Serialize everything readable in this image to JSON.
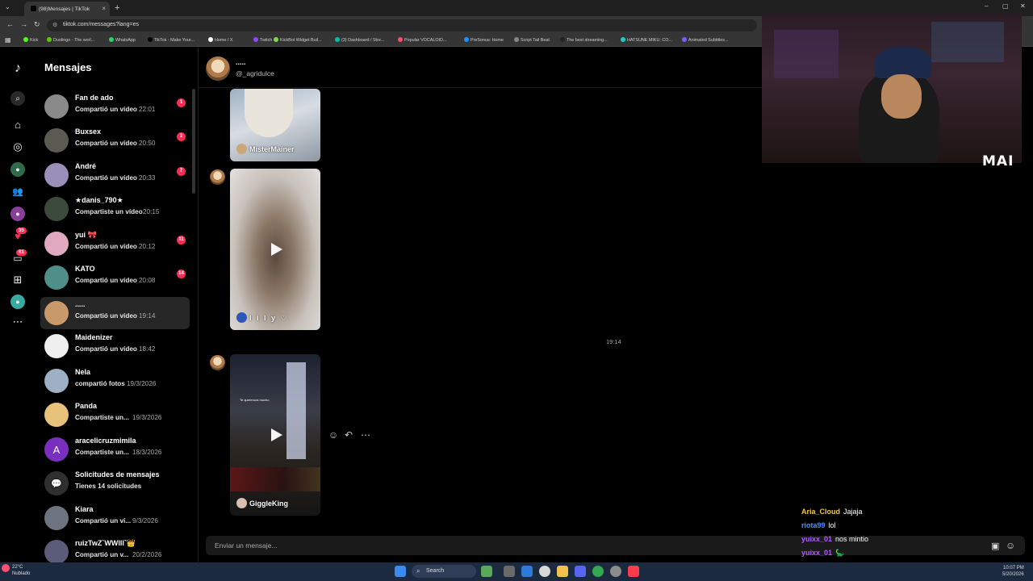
{
  "browser": {
    "tab_title": "(98)Mensajes | TikTok",
    "url": "tiktok.com/messages?lang=es",
    "bookmarks": [
      "Kick",
      "Duolingo - The worl...",
      "WhatsApp",
      "TikTok - Make Your...",
      "Home / X",
      "Twitch",
      "KickBot Widget Buil...",
      "(3) Dashboard / Stre...",
      "Popular VOCALOID...",
      "PreSonus: Home",
      "Script Tail Beat",
      "The best streaming...",
      "HATSUNE MIKU: CO...",
      "Animated Subtitles..."
    ]
  },
  "rail": {
    "badges": {
      "likes": "35",
      "inbox": "61"
    }
  },
  "sidebar": {
    "title": "Mensajes",
    "conversations": [
      {
        "name": "Fan de ado",
        "subtitle": "Compartió un vídeo",
        "time": "22:01",
        "badge": "1",
        "color": "#8a8a8a"
      },
      {
        "name": "Buxsex",
        "subtitle": "Compartió un vídeo",
        "time": "20:50",
        "badge": "2",
        "color": "#5a5a52"
      },
      {
        "name": "André",
        "subtitle": "Compartió un vídeo",
        "time": "20:33",
        "badge": "7",
        "color": "#9a8fb8"
      },
      {
        "name": "★danis_790★",
        "subtitle": "Compartiste un vídeo",
        "time": "20:15",
        "badge": "",
        "color": "#3b4a3a"
      },
      {
        "name": "yui 🎀",
        "subtitle": "Compartió un vídeo",
        "time": "20:12",
        "badge": "11",
        "color": "#e0a9c0"
      },
      {
        "name": "KATO",
        "subtitle": "Compartió un vídeo",
        "time": "20:08",
        "badge": "14",
        "color": "#4f8f8a"
      },
      {
        "name": ".....",
        "subtitle": "Compartió un vídeo",
        "time": "19:14",
        "badge": "",
        "color": "#c89a6a"
      },
      {
        "name": "Maidenizer",
        "subtitle": "Compartió un vídeo",
        "time": "18:42",
        "badge": "",
        "color": "#efefef"
      },
      {
        "name": "Nela",
        "subtitle": "compartió fotos",
        "time": "19/3/2026",
        "badge": "",
        "color": "#9fb0c4"
      },
      {
        "name": "Panda",
        "subtitle": "Compartiste un...",
        "time": "19/3/2026",
        "badge": "",
        "color": "#e8c27a"
      },
      {
        "name": "aracelicruzmimila",
        "subtitle": "Compartiste un...",
        "time": "18/3/2026",
        "badge": "",
        "color": "#7b2fbf",
        "initial": "A"
      },
      {
        "name": "Solicitudes de mensajes",
        "subtitle": "Tienes 14 solicitudes",
        "time": "",
        "badge": "",
        "color": "#2f2f2f"
      },
      {
        "name": "Kiara",
        "subtitle": "Compartió un ví...",
        "time": "9/3/2026",
        "badge": "",
        "color": "#6d7480"
      },
      {
        "name": "ruizTwZ`WWIII`👑",
        "subtitle": "Compartió un v...",
        "time": "20/2/2026",
        "badge": "",
        "color": "#5a5c7a"
      }
    ]
  },
  "chat": {
    "name": ".....",
    "handle": "@_agridulce",
    "videos": [
      {
        "author": "MisterMainer"
      },
      {
        "author": "l i l y ♡"
      },
      {
        "author": "GiggleKing",
        "overlay_text": "Te quereruos mucho"
      }
    ],
    "timestamp": "19:14",
    "input_placeholder": "Enviar un mensaje..."
  },
  "stream_overlay": {
    "logo": "MAI",
    "chat": [
      {
        "user": "Aria_Cloud",
        "message": "Jajaja",
        "color": "#f2c94c"
      },
      {
        "user": "riota99",
        "message": "lol",
        "color": "#4a8cff"
      },
      {
        "user": "yuixx_01",
        "message": "nos mintio",
        "color": "#b05cff"
      },
      {
        "user": "yuixx_01",
        "message": "🦕",
        "color": "#b05cff"
      }
    ]
  },
  "taskbar": {
    "weather_temp": "22°C",
    "weather_desc": "Nublado",
    "search": "Search",
    "time": "10:07 PM",
    "date": "5/20/2026"
  }
}
